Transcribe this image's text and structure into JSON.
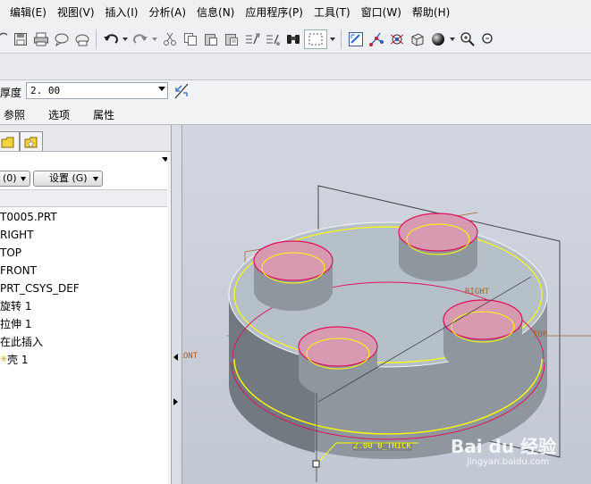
{
  "menu": [
    "编辑(E)",
    "视图(V)",
    "插入(I)",
    "分析(A)",
    "信息(N)",
    "应用程序(P)",
    "工具(T)",
    "窗口(W)",
    "帮助(H)"
  ],
  "toolbar_icons": [
    "refresh-icon",
    "save-icon",
    "print-icon",
    "send-icon",
    "send-mail-icon",
    "undo-icon",
    "redo-icon",
    "cut-icon",
    "copy-icon",
    "paste-icon",
    "paste-special-icon",
    "regenerate-icon",
    "regen-manager-icon",
    "find-icon",
    "select-box-icon",
    "repaint-icon",
    "spin-center-icon",
    "orient-icon",
    "saved-views-icon",
    "shading-icon",
    "zoom-in-icon",
    "zoom-out-icon"
  ],
  "dashboard": {
    "thickness_label": "厚度",
    "thickness_value": "2. 00",
    "tabs": [
      "参照",
      "选项",
      "属性"
    ]
  },
  "model_tree": {
    "button_filter": "(0)",
    "button_settings": "设置 (G)",
    "items": [
      "T0005.PRT",
      "RIGHT",
      "TOP",
      "FRONT",
      "PRT_CSYS_DEF",
      "旋转 1",
      "拉伸 1",
      "在此插入",
      "壳 1"
    ]
  },
  "viewport": {
    "labels": {
      "right": "RIGHT",
      "top": "TOP",
      "front": "FRONT",
      "thick_dim": "2.00 0_THICK"
    },
    "watermark": {
      "brand": "Bai du 经验",
      "url": "jingyan.baidu.com"
    },
    "colors": {
      "body": "#8f969e",
      "top_face": "#b6c0c8",
      "pink": "#d79ab0",
      "highlight": "#ffff00",
      "edge": "#e0105c"
    }
  }
}
